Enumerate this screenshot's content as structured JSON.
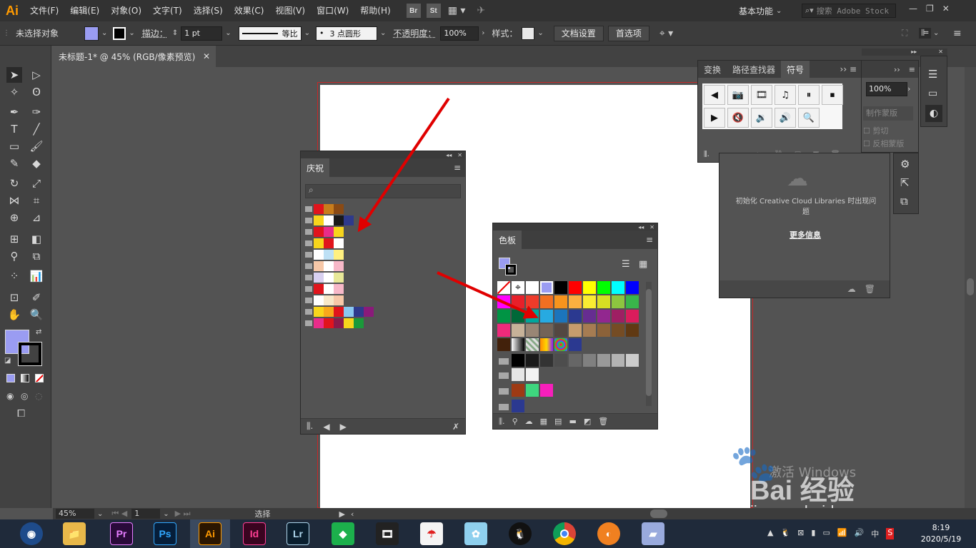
{
  "app": {
    "logo": "Ai",
    "menus": [
      "文件(F)",
      "编辑(E)",
      "对象(O)",
      "文字(T)",
      "选择(S)",
      "效果(C)",
      "视图(V)",
      "窗口(W)",
      "帮助(H)"
    ],
    "bridge_label": "Br",
    "stock_label": "St",
    "workspace": "基本功能",
    "search_placeholder": "搜索 Adobe Stock"
  },
  "control_bar": {
    "selection_label": "未选择对象",
    "stroke_label": "描边：",
    "stroke_weight": "1 pt",
    "stroke_profile": "等比",
    "brush": "3 点圆形",
    "opacity_label": "不透明度：",
    "opacity_value": "100%",
    "style_label": "样式：",
    "doc_setup_button": "文档设置",
    "prefs_button": "首选项"
  },
  "document": {
    "tab_title": "未标题-1* @ 45% (RGB/像素预览)"
  },
  "celebration_panel": {
    "title": "庆祝",
    "rows": [
      [
        "#e0141c",
        "#c87d1c",
        "#8a4a14"
      ],
      [
        "#f7d51c",
        "#ffffff",
        "#1a1a1a",
        "#2e3a8c"
      ],
      [
        "#e0141c",
        "#e82c8a",
        "#f7d51c"
      ],
      [
        "#f7d51c",
        "#e0141c",
        "#ffffff"
      ],
      [
        "#ffffff",
        "#bde0f5",
        "#fff080"
      ],
      [
        "#f7c8a8",
        "#ffffff",
        "#f7b8c8"
      ],
      [
        "#d8d0f0",
        "#ffffff",
        "#e8e898"
      ],
      [
        "#e0141c",
        "#ffffff",
        "#f7b8c8"
      ],
      [
        "#ffffff",
        "#f7e8c8",
        "#f7c8a8"
      ],
      [
        "#f7d51c",
        "#f7a81c",
        "#e0141c",
        "#8ac8f0",
        "#2e3a8c",
        "#8a1a7a"
      ],
      [
        "#e82c8a",
        "#e0141c",
        "#8a1a4a",
        "#f7d51c",
        "#1a9a3a"
      ]
    ]
  },
  "swatches_panel": {
    "title": "色板",
    "rows": [
      [
        "none",
        "registration",
        "#ffffff",
        "#9a9cf2",
        "#000000",
        "#ff0000",
        "#ffff00",
        "#00ff00",
        "#00ffff",
        "#0000ff"
      ],
      [
        "#ff00ff",
        "#e8202a",
        "#ee3b2a",
        "#f26f21",
        "#f7941d",
        "#fbb040",
        "#f9ed32",
        "#d7df23",
        "#8dc63f",
        "#39b54a"
      ],
      [
        "#009444",
        "#006838",
        "#00a79d",
        "#27aae1",
        "#1c75bc",
        "#2b3990",
        "#662d91",
        "#92278f",
        "#9e1f63",
        "#da1c5c"
      ],
      [
        "#ee2a7b",
        "#c7b299",
        "#998675",
        "#736357",
        "#534741",
        "#c69c6d",
        "#a67c52",
        "#8c6239",
        "#754c24",
        "#603913"
      ],
      [
        "#42210b",
        "gradient",
        "pattern",
        "gradient2",
        "pattern2",
        "#2b3990"
      ],
      [
        "#000000",
        "#1a1a1a",
        "#333333",
        "#4d4d4d",
        "#666666",
        "#808080",
        "#999999",
        "#b3b3b3",
        "#cccccc"
      ],
      [
        "#e6e6e6",
        "#f2f2f2"
      ],
      [
        "#9e3a14",
        "#3ed67e",
        "#f71fbb"
      ],
      [
        "#2b3990"
      ]
    ]
  },
  "symbols_panel": {
    "tabs": [
      "变换",
      "路径查找器",
      "符号"
    ],
    "active_tab": "符号",
    "symbols_row1": [
      "◀",
      "📷",
      "🎞",
      "♫",
      "⏸",
      "⏹"
    ],
    "symbols_row2": [
      "▶",
      "🔇",
      "🔉",
      "🔊",
      "🔍"
    ]
  },
  "right_partial_panel": {
    "zoom": "100%",
    "make_mask": "制作蒙版",
    "clip": "剪切",
    "invert_mask": "反相蒙版"
  },
  "cc_panel": {
    "message": "初始化 Creative Cloud Libraries 时出现问题",
    "more_info": "更多信息"
  },
  "status_bar": {
    "zoom": "45%",
    "page": "1",
    "tool": "选择"
  },
  "watermark": {
    "line1": "激活 Windows",
    "brand": "Bai 经验",
    "site": "jingyan.baidu.com"
  },
  "taskbar": {
    "apps": [
      {
        "name": "Pr",
        "color": "#2a0a3a",
        "fg": "#e67cff"
      },
      {
        "name": "Ps",
        "color": "#061e3a",
        "fg": "#31a8ff"
      },
      {
        "name": "Ai",
        "color": "#2b1600",
        "fg": "#ff9a00"
      },
      {
        "name": "Id",
        "color": "#3a0420",
        "fg": "#ff3f94"
      },
      {
        "name": "Lr",
        "color": "#0a1e2e",
        "fg": "#add5ec"
      }
    ],
    "time": "8:19",
    "date": "2020/5/19",
    "ime": "中"
  }
}
